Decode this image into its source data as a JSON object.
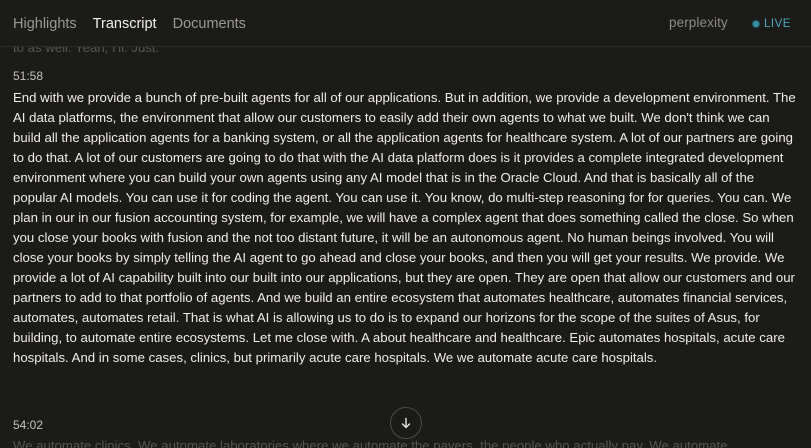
{
  "header": {
    "tabs": [
      {
        "label": "Highlights",
        "active": false
      },
      {
        "label": "Transcript",
        "active": true
      },
      {
        "label": "Documents",
        "active": false
      }
    ],
    "brand": "perplexity",
    "live_label": "LIVE"
  },
  "transcript": {
    "previous_tail": "to as well. Yeah, I'll. Just.",
    "segments": [
      {
        "time": "51:58",
        "text": "End with we provide a bunch of pre-built agents for all of our applications. But in addition, we provide a development environment. The AI data platforms, the environment that allow our customers to easily add their own agents to what we built. We don't think we can build all the application agents for a banking system, or all the application agents for healthcare system. A lot of our partners are going to do that. A lot of our customers are going to do that with the AI data platform does is it provides a complete integrated development environment where you can build your own agents using any AI model that is in the Oracle Cloud. And that is basically all of the popular AI models. You can use it for coding the agent. You can use it. You know, do multi-step reasoning for for queries. You can. We plan in our in our fusion accounting system, for example, we will have a complex agent that does something called the close. So when you close your books with fusion and the not too distant future, it will be an autonomous agent. No human beings involved. You will close your books by simply telling the AI agent to go ahead and close your books, and then you will get your results. We provide. We provide a lot of AI capability built into our built into our applications, but they are open. They are open that allow our customers and our partners to add to that portfolio of agents. And we build an entire ecosystem that automates healthcare, automates financial services, automates, automates retail. That is what AI is allowing us to do is to expand our horizons for the scope of the suites of Asus, for building, to automate entire ecosystems. Let me close with. A about healthcare and healthcare. Epic automates hospitals, acute care hospitals. And in some cases, clinics, but primarily acute care hospitals. We we automate acute care hospitals."
      },
      {
        "time": "54:02",
        "text": "We automate clinics. We automate laboratories where we automate the payers, the people who actually pay. We automate"
      }
    ]
  },
  "colors": {
    "background": "#1b1b19",
    "text": "#eeede8",
    "live_accent": "#4fa8b8"
  },
  "icons": {
    "scroll_down": "arrow-down-icon",
    "live": "live-dot-icon"
  }
}
